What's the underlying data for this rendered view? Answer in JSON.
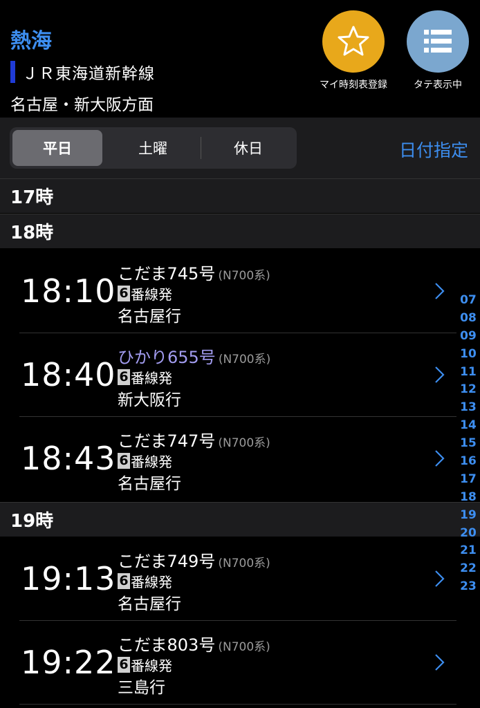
{
  "header": {
    "station": "熱海",
    "line": "ＪＲ東海道新幹線",
    "direction": "名古屋・新大阪方面",
    "fav_label": "マイ時刻表登録",
    "view_label": "タテ表示中"
  },
  "tabs": {
    "weekday": "平日",
    "saturday": "土曜",
    "holiday": "休日",
    "date_select": "日付指定"
  },
  "hours": {
    "h17": "17時",
    "h18": "18時",
    "h19": "19時"
  },
  "trains": [
    {
      "time": "18:10",
      "name": "こだま745号",
      "type": "(N700系)",
      "platform": "6",
      "platform_suffix": "番線発",
      "dest": "名古屋行"
    },
    {
      "time": "18:40",
      "name": "ひかり655号",
      "type": "(N700系)",
      "platform": "6",
      "platform_suffix": "番線発",
      "dest": "新大阪行"
    },
    {
      "time": "18:43",
      "name": "こだま747号",
      "type": "(N700系)",
      "platform": "6",
      "platform_suffix": "番線発",
      "dest": "名古屋行"
    },
    {
      "time": "19:13",
      "name": "こだま749号",
      "type": "(N700系)",
      "platform": "6",
      "platform_suffix": "番線発",
      "dest": "名古屋行"
    },
    {
      "time": "19:22",
      "name": "こだま803号",
      "type": "(N700系)",
      "platform": "6",
      "platform_suffix": "番線発",
      "dest": "三島行"
    }
  ],
  "hour_index": [
    "07",
    "08",
    "09",
    "10",
    "11",
    "12",
    "13",
    "14",
    "15",
    "16",
    "17",
    "18",
    "19",
    "20",
    "21",
    "22",
    "23"
  ],
  "colors": {
    "accent": "#3d8ef0",
    "favorite": "#e8a81b",
    "view": "#7ba7cf",
    "hikari": "#a29cf0"
  }
}
